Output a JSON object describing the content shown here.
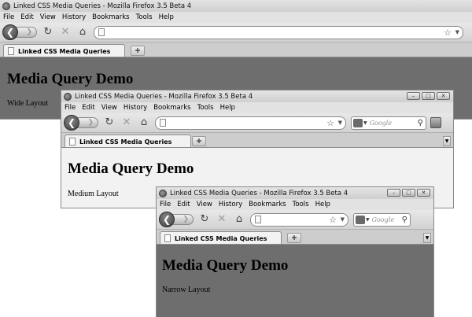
{
  "windows": [
    {
      "title": "Linked CSS Media Queries - Mozilla Firefox 3.5 Beta 4",
      "menu": [
        "File",
        "Edit",
        "View",
        "History",
        "Bookmarks",
        "Tools",
        "Help"
      ],
      "tab_label": "Linked CSS Media Queries",
      "heading": "Media Query Demo",
      "layout_text": "Wide Layout",
      "content_bg": "#6e6e6e"
    },
    {
      "title": "Linked CSS Media Queries - Mozilla Firefox 3.5 Beta 4",
      "menu": [
        "File",
        "Edit",
        "View",
        "History",
        "Bookmarks",
        "Tools",
        "Help"
      ],
      "tab_label": "Linked CSS Media Queries",
      "heading": "Media Query Demo",
      "layout_text": "Medium Layout",
      "search_placeholder": "Google",
      "content_bg": "#f2f2f2"
    },
    {
      "title": "Linked CSS Media Queries - Mozilla Firefox 3.5 Beta 4",
      "menu": [
        "File",
        "Edit",
        "View",
        "History",
        "Bookmarks",
        "Tools",
        "Help"
      ],
      "tab_label": "Linked CSS Media Queries",
      "heading": "Media Query Demo",
      "layout_text": "Narrow Layout",
      "search_placeholder": "Google",
      "content_bg": "#6e6e6e"
    }
  ],
  "icons": {
    "back": "back-arrow-icon",
    "forward": "forward-arrow-icon",
    "reload": "reload-icon",
    "stop": "stop-icon",
    "home": "home-icon",
    "bookmark_star": "star-icon",
    "search": "magnifier-icon",
    "new_tab": "plus-icon"
  }
}
